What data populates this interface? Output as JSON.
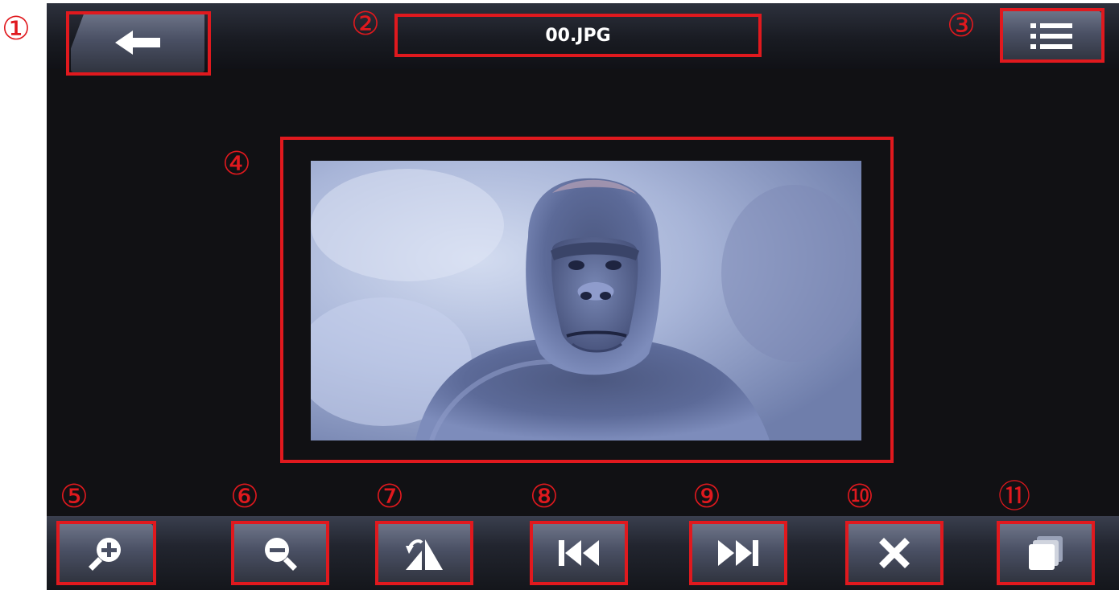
{
  "header": {
    "title": "00.JPG",
    "back_icon": "arrow-left-icon",
    "menu_icon": "list-menu-icon"
  },
  "viewer": {
    "image_subject": "gorilla"
  },
  "toolbar": {
    "items": [
      {
        "name": "zoom-in-button",
        "icon": "zoom-in-icon"
      },
      {
        "name": "zoom-out-button",
        "icon": "zoom-out-icon"
      },
      {
        "name": "rotate-button",
        "icon": "rotate-icon"
      },
      {
        "name": "previous-button",
        "icon": "skip-previous-icon"
      },
      {
        "name": "next-button",
        "icon": "skip-next-icon"
      },
      {
        "name": "close-button",
        "icon": "close-icon"
      },
      {
        "name": "slideshow-button",
        "icon": "slideshow-icon"
      }
    ]
  },
  "annotations": {
    "markers": [
      "①",
      "②",
      "③",
      "④",
      "⑤",
      "⑥",
      "⑦",
      "⑧",
      "⑨",
      "⑩",
      "⑪"
    ],
    "color": "#e0191e"
  },
  "colors": {
    "screen_background": "#111114",
    "button_gradient_top": "#6d7488",
    "button_gradient_bottom": "#30343f"
  }
}
